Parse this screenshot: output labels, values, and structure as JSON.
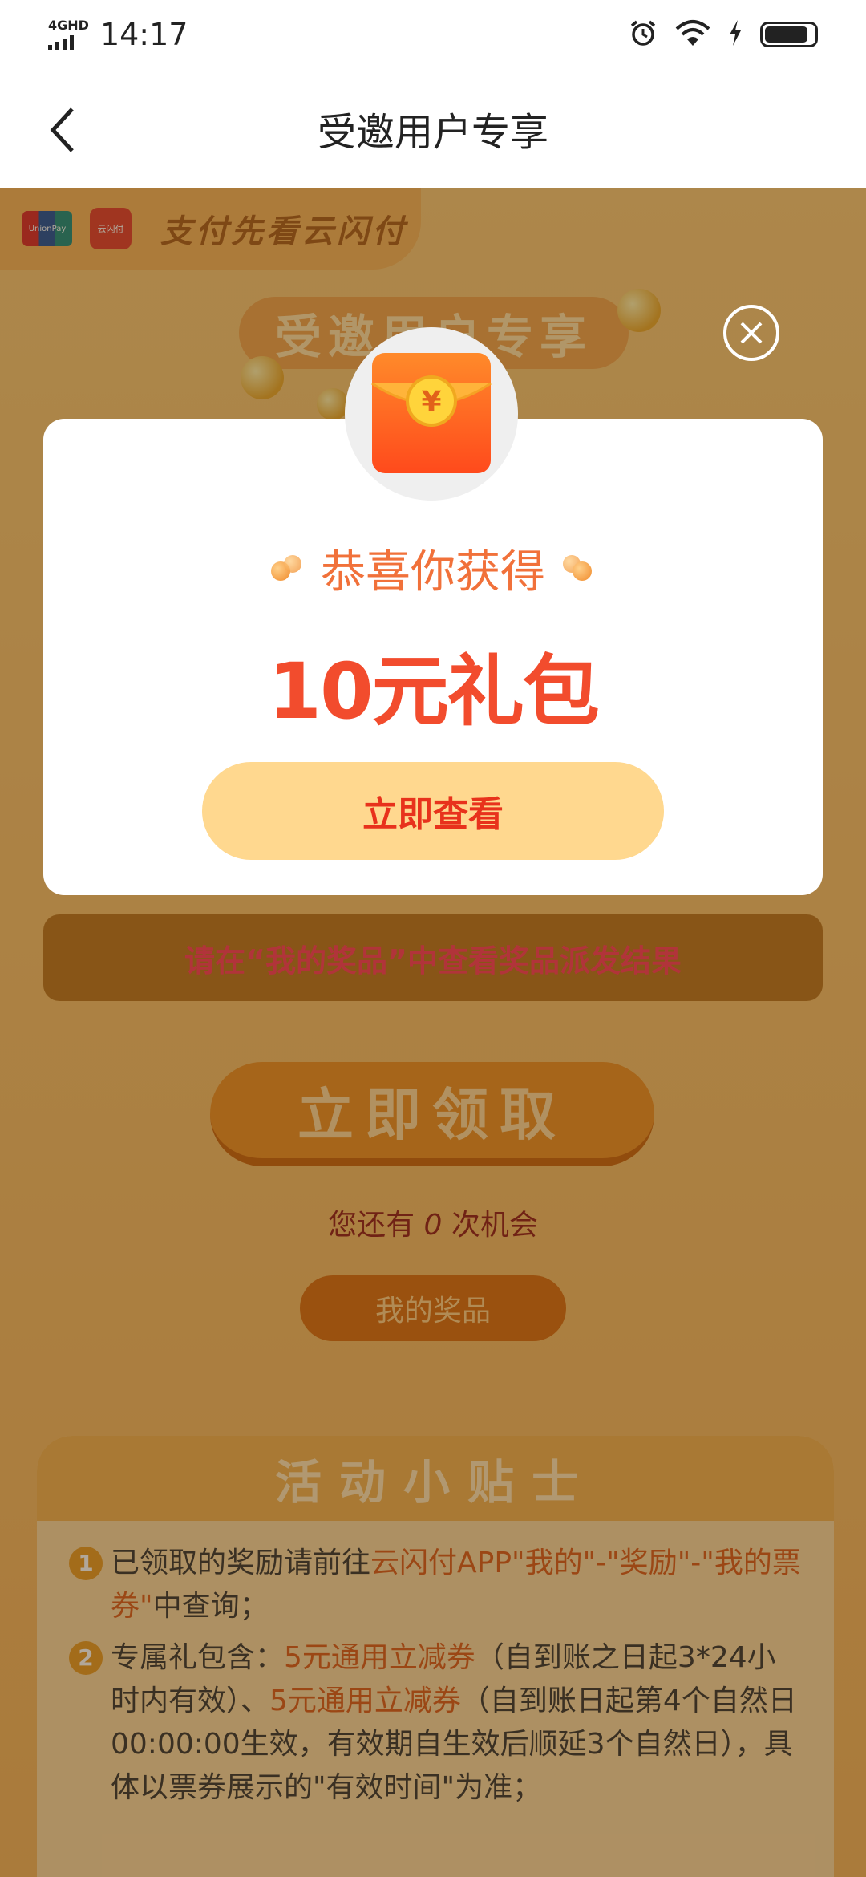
{
  "status_bar": {
    "network": "4GHD",
    "time": "14:17"
  },
  "header": {
    "title": "受邀用户专享"
  },
  "background": {
    "brand": {
      "unionpay_logo": "UnionPay",
      "ysf_logo": "云闪付",
      "slogan": "支付先看云闪付"
    },
    "promo_badge": "受邀用户专享",
    "notice": "请在“我的奖品”中查看奖品派发结果",
    "claim_button": "立即领取",
    "chances": {
      "prefix": "您还有",
      "count": "0",
      "suffix": "次机会"
    },
    "my_prizes_button": "我的奖品",
    "tips": {
      "title": "活动小贴士",
      "items": [
        {
          "num": "1",
          "parts": [
            "已领取的奖励请前往",
            "云闪付APP\"我的\"-\"奖励\"-\"我的票券\"",
            "中查询；"
          ]
        },
        {
          "num": "2",
          "parts": [
            "专属礼包含：",
            "5元通用立减券",
            "（自到账之日起3*24小时内有效）、",
            "5元通用立减券",
            "（自到账日起第4个自然日00:00:00生效，有效期自生效后顺延3个自然日），具体以票券展示的\"有效时间\"为准；"
          ]
        }
      ]
    }
  },
  "modal": {
    "congrats": "恭喜你获得",
    "prize": "10元礼包",
    "view_button": "立即查看",
    "currency_symbol": "¥"
  },
  "colors": {
    "accent_orange": "#f1713a",
    "prize_red": "#f24c2d",
    "button_yellow": "#ffd88f",
    "notice_pink": "#ff3a5b"
  }
}
